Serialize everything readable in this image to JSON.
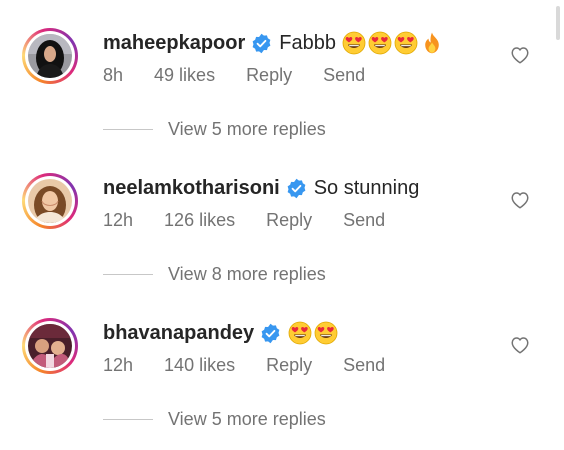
{
  "comments": [
    {
      "username": "maheepkapoor",
      "text": "Fabbb",
      "emojis": [
        "heart-eyes-emoji",
        "heart-eyes-emoji",
        "heart-eyes-emoji",
        "fire-emoji"
      ],
      "time": "8h",
      "likes": "49 likes",
      "reply": "Reply",
      "send": "Send",
      "view_replies": "View 5 more replies"
    },
    {
      "username": "neelamkotharisoni",
      "text": "So stunning",
      "emojis": [],
      "time": "12h",
      "likes": "126 likes",
      "reply": "Reply",
      "send": "Send",
      "view_replies": "View 8 more replies"
    },
    {
      "username": "bhavanapandey",
      "text": "",
      "emojis": [
        "heart-eyes-emoji",
        "heart-eyes-emoji"
      ],
      "time": "12h",
      "likes": "140 likes",
      "reply": "Reply",
      "send": "Send",
      "view_replies": "View 5 more replies"
    }
  ],
  "colors": {
    "verified": "#3897f0",
    "meta_text": "#737373",
    "username": "#262626"
  }
}
